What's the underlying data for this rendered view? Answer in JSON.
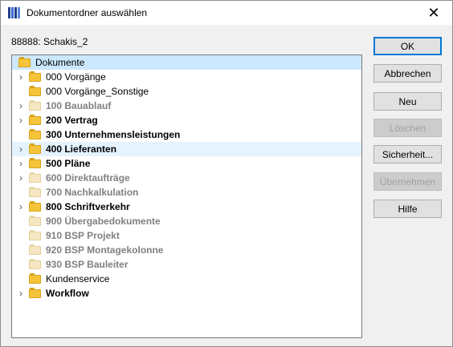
{
  "window": {
    "title": "Dokumentordner auswählen",
    "close_glyph": "✕"
  },
  "path_label": "88888: Schakis_2",
  "tree": {
    "root": {
      "label": "Dokumente"
    },
    "items": [
      {
        "label": "000 Vorgänge",
        "expander": true,
        "bold": false,
        "dim": false
      },
      {
        "label": "000 Vorgänge_Sonstige",
        "expander": false,
        "bold": false,
        "dim": false
      },
      {
        "label": "100 Bauablauf",
        "expander": true,
        "bold": true,
        "dim": true
      },
      {
        "label": "200 Vertrag",
        "expander": true,
        "bold": true,
        "dim": false
      },
      {
        "label": "300 Unternehmensleistungen",
        "expander": false,
        "bold": true,
        "dim": false
      },
      {
        "label": "400 Lieferanten",
        "expander": true,
        "bold": true,
        "dim": false
      },
      {
        "label": "500 Pläne",
        "expander": true,
        "bold": true,
        "dim": false
      },
      {
        "label": "600 Direktaufträge",
        "expander": true,
        "bold": true,
        "dim": true
      },
      {
        "label": "700 Nachkalkulation",
        "expander": false,
        "bold": true,
        "dim": true
      },
      {
        "label": "800 Schriftverkehr",
        "expander": true,
        "bold": true,
        "dim": false
      },
      {
        "label": "900 Übergabedokumente",
        "expander": false,
        "bold": true,
        "dim": true
      },
      {
        "label": "910 BSP Projekt",
        "expander": false,
        "bold": true,
        "dim": true
      },
      {
        "label": "920 BSP Montagekolonne",
        "expander": false,
        "bold": true,
        "dim": true
      },
      {
        "label": "930 BSP Bauleiter",
        "expander": false,
        "bold": true,
        "dim": true
      },
      {
        "label": "Kundenservice",
        "expander": false,
        "bold": false,
        "dim": false
      },
      {
        "label": "Workflow",
        "expander": true,
        "bold": true,
        "dim": false
      }
    ]
  },
  "buttons": {
    "ok": "OK",
    "cancel": "Abbrechen",
    "new": "Neu",
    "delete": "Löschen",
    "security": "Sicherheit...",
    "apply": "Übernehmen",
    "help": "Hilfe"
  }
}
